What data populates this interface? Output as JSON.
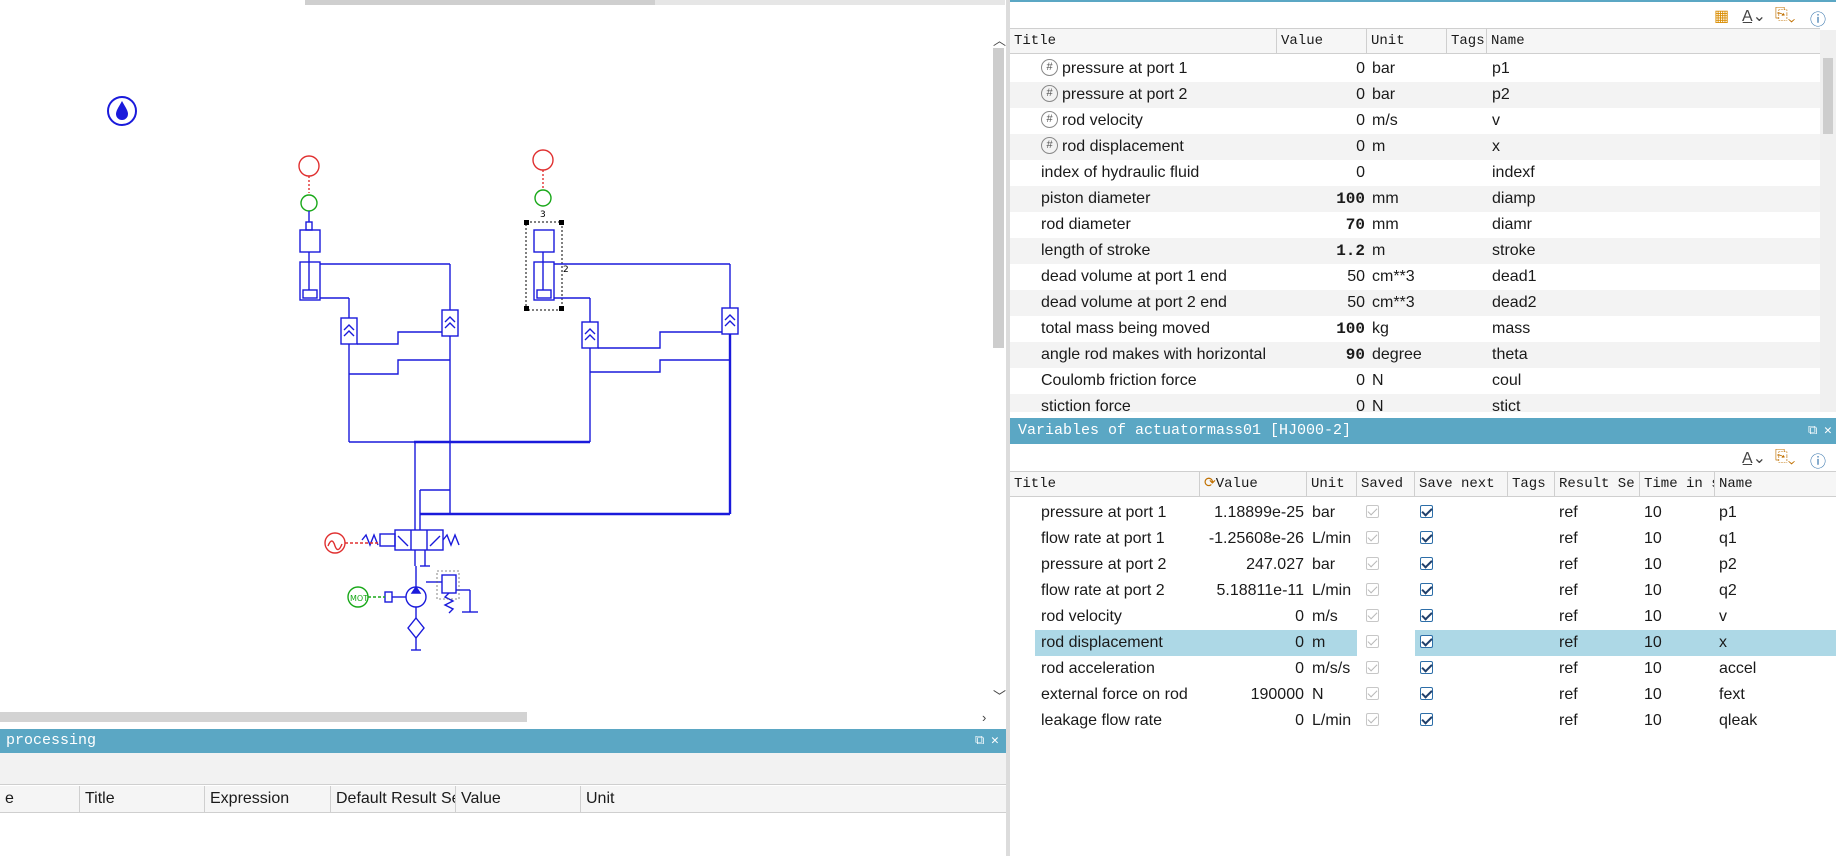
{
  "colors": {
    "accent": "#5ba7c4",
    "circuit": "#1a1adb",
    "sensor_red": "#e03030",
    "sensor_green": "#18a818",
    "selection": "#add8e6"
  },
  "icons": [
    "water-drop-icon",
    "layout-icon",
    "font-icon",
    "export-icon",
    "help-icon",
    "pin-icon",
    "close-icon",
    "hash-icon"
  ],
  "post_processing": {
    "title": "processing",
    "columns": [
      "e",
      "Title",
      "Expression",
      "Default Result Se",
      "Value",
      "Unit"
    ]
  },
  "parameters": {
    "columns": [
      "Title",
      "Value",
      "Unit",
      "Tags",
      "Name"
    ],
    "rows": [
      {
        "title": "pressure at port 1",
        "value": "0",
        "unit": "bar",
        "name": "p1",
        "hash": true,
        "bold": false
      },
      {
        "title": "pressure at port 2",
        "value": "0",
        "unit": "bar",
        "name": "p2",
        "hash": true,
        "bold": false
      },
      {
        "title": "rod velocity",
        "value": "0",
        "unit": "m/s",
        "name": "v",
        "hash": true,
        "bold": false
      },
      {
        "title": "rod displacement",
        "value": "0",
        "unit": "m",
        "name": "x",
        "hash": true,
        "bold": false
      },
      {
        "title": "index of hydraulic fluid",
        "value": "0",
        "unit": "",
        "name": "indexf",
        "hash": false,
        "bold": false
      },
      {
        "title": "piston diameter",
        "value": "100",
        "unit": "mm",
        "name": "diamp",
        "hash": false,
        "bold": true
      },
      {
        "title": "rod diameter",
        "value": "70",
        "unit": "mm",
        "name": "diamr",
        "hash": false,
        "bold": true
      },
      {
        "title": "length of stroke",
        "value": "1.2",
        "unit": "m",
        "name": "stroke",
        "hash": false,
        "bold": true
      },
      {
        "title": "dead volume at port 1 end",
        "value": "50",
        "unit": "cm**3",
        "name": "dead1",
        "hash": false,
        "bold": false
      },
      {
        "title": "dead volume at port 2 end",
        "value": "50",
        "unit": "cm**3",
        "name": "dead2",
        "hash": false,
        "bold": false
      },
      {
        "title": "total mass being moved",
        "value": "100",
        "unit": "kg",
        "name": "mass",
        "hash": false,
        "bold": true
      },
      {
        "title": "angle rod makes with horizontal",
        "value": "90",
        "unit": "degree",
        "name": "theta",
        "hash": false,
        "bold": true
      },
      {
        "title": "Coulomb friction force",
        "value": "0",
        "unit": "N",
        "name": "coul",
        "hash": false,
        "bold": false
      },
      {
        "title": "stiction force",
        "value": "0",
        "unit": "N",
        "name": "stict",
        "hash": false,
        "bold": false
      }
    ]
  },
  "variables": {
    "title": "Variables of actuatormass01 [HJ000-2]",
    "columns": [
      "Title",
      "Value",
      "Unit",
      "Saved",
      "Save next",
      "Tags",
      "Result Se",
      "Time in s",
      "Name"
    ],
    "rows": [
      {
        "title": "pressure at port 1",
        "value": "1.18899e-25",
        "unit": "bar",
        "result": "ref",
        "time": "10",
        "name": "p1"
      },
      {
        "title": "flow rate at port 1",
        "value": "-1.25608e-26",
        "unit": "L/min",
        "result": "ref",
        "time": "10",
        "name": "q1"
      },
      {
        "title": "pressure at port 2",
        "value": "247.027",
        "unit": "bar",
        "result": "ref",
        "time": "10",
        "name": "p2"
      },
      {
        "title": "flow rate at port 2",
        "value": "5.18811e-11",
        "unit": "L/min",
        "result": "ref",
        "time": "10",
        "name": "q2"
      },
      {
        "title": "rod velocity",
        "value": "0",
        "unit": "m/s",
        "result": "ref",
        "time": "10",
        "name": "v"
      },
      {
        "title": "rod displacement",
        "value": "0",
        "unit": "m",
        "result": "ref",
        "time": "10",
        "name": "x"
      },
      {
        "title": "rod acceleration",
        "value": "0",
        "unit": "m/s/s",
        "result": "ref",
        "time": "10",
        "name": "accel"
      },
      {
        "title": "external force on rod",
        "value": "190000",
        "unit": "N",
        "result": "ref",
        "time": "10",
        "name": "fext"
      },
      {
        "title": "leakage flow rate",
        "value": "0",
        "unit": "L/min",
        "result": "ref",
        "time": "10",
        "name": "qleak"
      }
    ],
    "selected_index": 5
  },
  "circuit_labels": {
    "actuator_right_port": "3",
    "actuator_right_side": "2",
    "motor": "MOT"
  }
}
